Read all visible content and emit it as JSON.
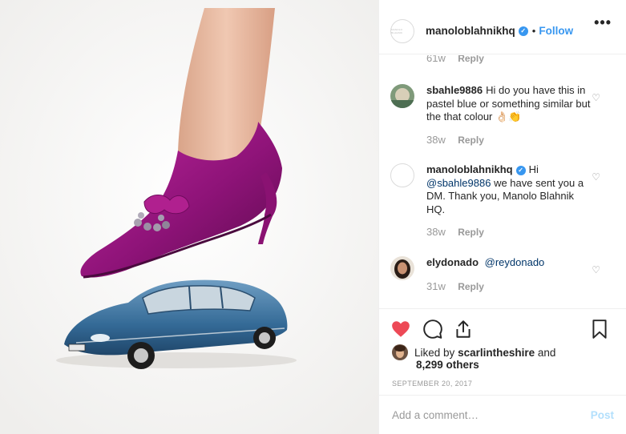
{
  "header": {
    "username": "manoloblahnikhq",
    "verified_glyph": "✓",
    "separator": "•",
    "follow_label": "Follow",
    "more_label": "•••",
    "avatar_text": "MANOLO BLAHNIK"
  },
  "partial_comment": {
    "age": "61w",
    "reply": "Reply"
  },
  "comments": [
    {
      "username": "sbahle9886",
      "text": "Hi do you have this in pastel blue or something similar but the that colour 👌🏻👏",
      "age": "38w",
      "reply": "Reply"
    },
    {
      "username": "manoloblahnikhq",
      "text_before": "Hi",
      "mention": "@sbahle9886",
      "text_after": "we have sent you a DM. Thank you, Manolo Blahnik HQ.",
      "age": "38w",
      "reply": "Reply"
    },
    {
      "username": "elydonado",
      "mention": "@reydonado",
      "age": "31w",
      "reply": "Reply"
    }
  ],
  "likes": {
    "prefix": "Liked by",
    "user": "scarlintheshire",
    "joiner": "and",
    "count": "8,299 others"
  },
  "date": "SEPTEMBER 20, 2017",
  "add_comment": {
    "placeholder": "Add a comment…",
    "post_label": "Post"
  },
  "icons": {
    "like": "heart-filled-icon",
    "comment": "comment-bubble-icon",
    "share": "share-upload-icon",
    "save": "bookmark-icon",
    "comment_like": "heart-outline-icon"
  },
  "colors": {
    "accent": "#3897f0",
    "like_red": "#ed4956",
    "shoe_magenta": "#9c1a86",
    "car_blue": "#3a6f9a"
  }
}
